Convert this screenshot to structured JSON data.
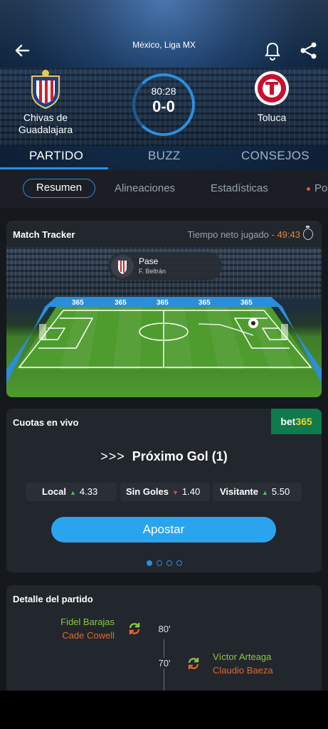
{
  "header": {
    "league": "México, Liga MX",
    "home_team": "Chivas de Guadalajara",
    "away_team": "Toluca",
    "clock": "80:28",
    "score": "0-0",
    "tabs": [
      "PARTIDO",
      "BUZZ",
      "CONSEJOS"
    ],
    "active_tab": "PARTIDO"
  },
  "subtabs": {
    "items": [
      "Resumen",
      "Alineaciones",
      "Estadísticas",
      "Po"
    ],
    "active": "Resumen"
  },
  "tracker": {
    "title": "Match Tracker",
    "neto_label": "Tiempo neto jugado - ",
    "neto_value": "49:43",
    "event_title": "Pase",
    "event_player": "F. Beltrán",
    "board_text": "365"
  },
  "odds": {
    "title": "Cuotas en vivo",
    "brand_a": "bet",
    "brand_b": "365",
    "arrows": ">>>",
    "next_goal": "Próximo Gol (1)",
    "markets": [
      {
        "label": "Local",
        "value": "4.33",
        "trend": "up"
      },
      {
        "label": "Sin Goles",
        "value": "1.40",
        "trend": "down"
      },
      {
        "label": "Visitante",
        "value": "5.50",
        "trend": "up"
      }
    ],
    "cta": "Apostar",
    "page_count": 4,
    "active_page": 1
  },
  "detail": {
    "title": "Detalle del partido",
    "events": [
      {
        "minute": "80'",
        "side": "home",
        "in": "Fidel Barajas",
        "out": "Cade Cowell"
      },
      {
        "minute": "70'",
        "side": "away",
        "in": "Víctor Arteaga",
        "out": "Claudio Baeza"
      }
    ]
  },
  "colors": {
    "accent": "#2b8fe0",
    "sub_in": "#8fc83a",
    "sub_out": "#e8652a",
    "bet365_green": "#0f7a4b",
    "bet365_yellow": "#f5d21e"
  }
}
